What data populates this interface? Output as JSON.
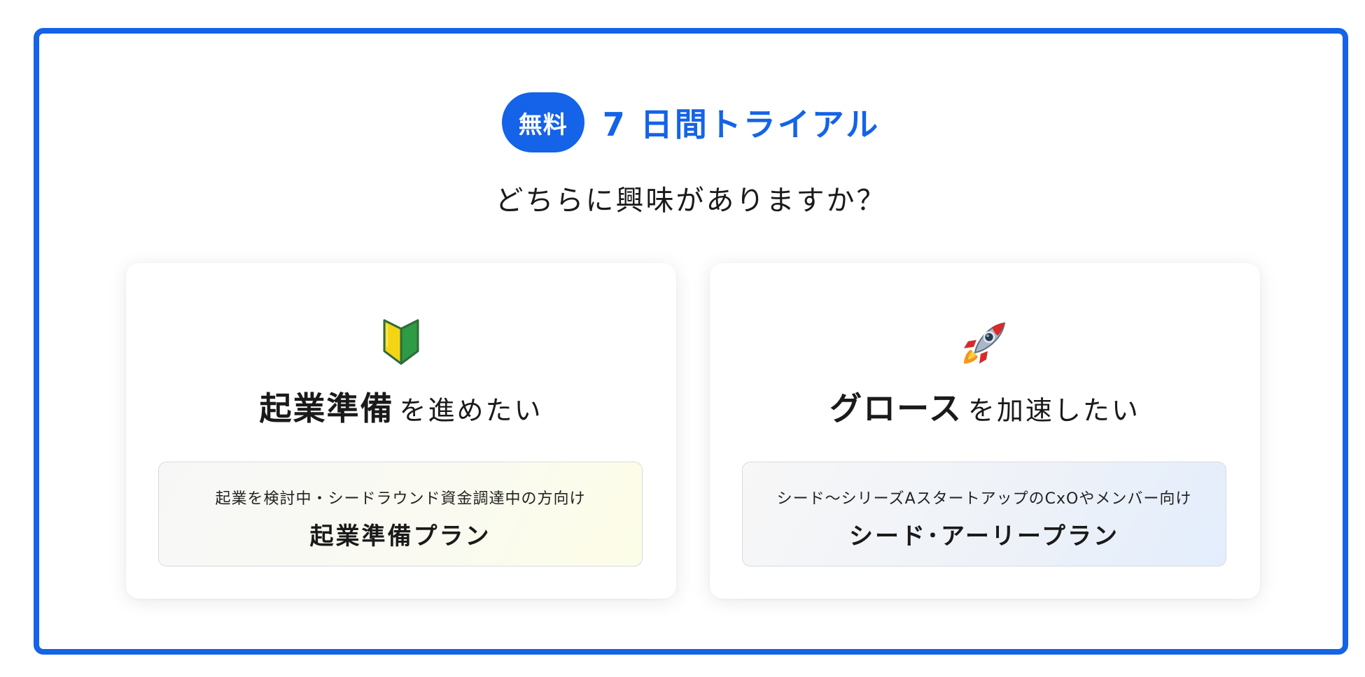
{
  "header": {
    "badge_label": "無料",
    "title": "7 日間トライアル",
    "question": "どちらに興味がありますか？"
  },
  "cards": [
    {
      "icon": "beginner-mark-icon",
      "heading_strong": "起業準備",
      "heading_rest": "を進めたい",
      "plan_description": "起業を検討中・シードラウンド資金調達中の方向け",
      "plan_name": "起業準備プラン"
    },
    {
      "icon": "rocket-icon",
      "heading_strong": "グロース",
      "heading_rest": "を加速したい",
      "plan_description": "シード〜シリーズAスタートアップのCxOやメンバー向け",
      "plan_name": "シード･アーリープラン"
    }
  ],
  "colors": {
    "accent": "#1463e8",
    "text": "#1a1a1a"
  }
}
